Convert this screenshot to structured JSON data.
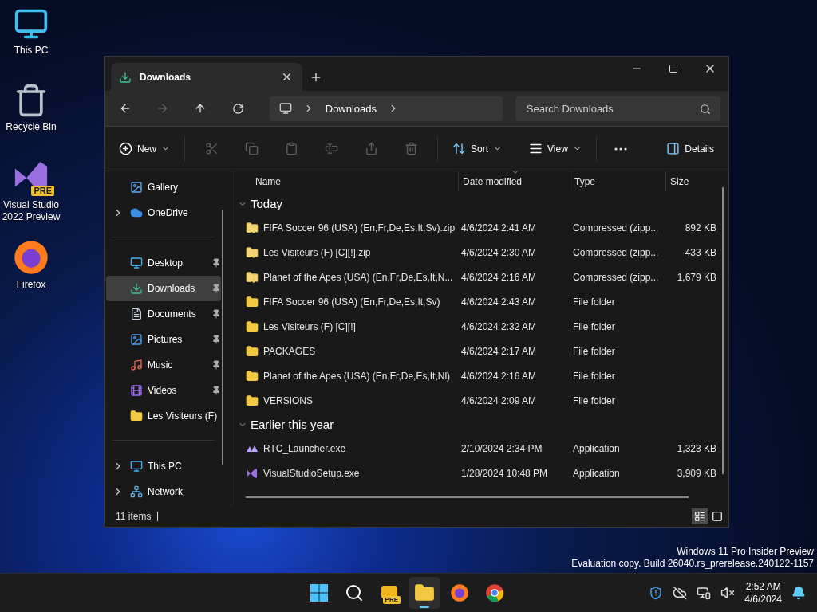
{
  "desktop_icons": [
    {
      "label": "This PC",
      "kind": "pc"
    },
    {
      "label": "Recycle Bin",
      "kind": "bin"
    },
    {
      "label": "Visual Studio 2022 Preview",
      "kind": "vs",
      "badge": "PRE"
    },
    {
      "label": "Firefox",
      "kind": "firefox"
    }
  ],
  "window": {
    "tab": {
      "title": "Downloads",
      "selected": true
    },
    "breadcrumb": [
      "Downloads"
    ],
    "search": {
      "placeholder": "Search Downloads"
    },
    "toolbar": {
      "new_label": "New",
      "actions": [
        {
          "disabled": true
        },
        {
          "disabled": true
        },
        {
          "disabled": true
        },
        {
          "disabled": true
        },
        {
          "disabled": true
        },
        {
          "disabled": true
        }
      ],
      "sort_label": "Sort",
      "view_label": "View",
      "details_label": "Details"
    },
    "sidebar": {
      "sections": [
        {
          "items": [
            {
              "label": "Gallery",
              "kind": "gallery",
              "expandable": false,
              "pinned": false,
              "selected": false
            },
            {
              "label": "OneDrive",
              "kind": "cloud",
              "expandable": true,
              "pinned": false,
              "selected": false
            }
          ]
        },
        {
          "items": [
            {
              "label": "Desktop",
              "kind": "desktop",
              "expandable": false,
              "pinned": true,
              "selected": false
            },
            {
              "label": "Downloads",
              "kind": "download",
              "expandable": false,
              "pinned": true,
              "selected": true
            },
            {
              "label": "Documents",
              "kind": "documents",
              "expandable": false,
              "pinned": true,
              "selected": false
            },
            {
              "label": "Pictures",
              "kind": "pictures",
              "expandable": false,
              "pinned": true,
              "selected": false
            },
            {
              "label": "Music",
              "kind": "music",
              "expandable": false,
              "pinned": true,
              "selected": false
            },
            {
              "label": "Videos",
              "kind": "videos",
              "expandable": false,
              "pinned": true,
              "selected": false
            },
            {
              "label": "Les Visiteurs (F)",
              "kind": "folder",
              "expandable": false,
              "pinned": false,
              "selected": false
            }
          ]
        },
        {
          "items": [
            {
              "label": "This PC",
              "kind": "pc",
              "expandable": true,
              "pinned": false,
              "selected": false
            },
            {
              "label": "Network",
              "kind": "network",
              "expandable": true,
              "pinned": false,
              "selected": false
            }
          ]
        }
      ]
    },
    "table": {
      "columns": [
        {
          "label": "Name",
          "sorted": false
        },
        {
          "label": "Date modified",
          "sorted": true
        },
        {
          "label": "Type",
          "sorted": false
        },
        {
          "label": "Size",
          "sorted": false
        }
      ],
      "groups": [
        {
          "title": "Today",
          "expanded": true,
          "rows": [
            {
              "kind": "zip",
              "name": "FIFA Soccer 96 (USA) (En,Fr,De,Es,It,Sv).zip",
              "date": "4/6/2024 2:41 AM",
              "type": "Compressed (zipp...",
              "size": "892 KB"
            },
            {
              "kind": "zip",
              "name": "Les Visiteurs (F) [C][!].zip",
              "date": "4/6/2024 2:30 AM",
              "type": "Compressed (zipp...",
              "size": "433 KB"
            },
            {
              "kind": "zip",
              "name": "Planet of the Apes (USA) (En,Fr,De,Es,It,N...",
              "date": "4/6/2024 2:16 AM",
              "type": "Compressed (zipp...",
              "size": "1,679 KB"
            },
            {
              "kind": "folder",
              "name": "FIFA Soccer 96 (USA) (En,Fr,De,Es,It,Sv)",
              "date": "4/6/2024 2:43 AM",
              "type": "File folder"
            },
            {
              "kind": "folder",
              "name": "Les Visiteurs (F) [C][!]",
              "date": "4/6/2024 2:32 AM",
              "type": "File folder"
            },
            {
              "kind": "folder",
              "name": "PACKAGES",
              "date": "4/6/2024 2:17 AM",
              "type": "File folder"
            },
            {
              "kind": "folder",
              "name": "Planet of the Apes (USA) (En,Fr,De,Es,It,Nl)",
              "date": "4/6/2024 2:16 AM",
              "type": "File folder"
            },
            {
              "kind": "folder",
              "name": "VERSIONS",
              "date": "4/6/2024 2:09 AM",
              "type": "File folder"
            }
          ]
        },
        {
          "title": "Earlier this year",
          "expanded": true,
          "rows": [
            {
              "kind": "rtc",
              "name": "RTC_Launcher.exe",
              "date": "2/10/2024 2:34 PM",
              "type": "Application",
              "size": "1,323 KB"
            },
            {
              "kind": "vs",
              "name": "VisualStudioSetup.exe",
              "date": "1/28/2024 10:48 PM",
              "type": "Application",
              "size": "3,909 KB"
            }
          ]
        }
      ]
    },
    "status_bar": {
      "count": "11 items",
      "views": [
        {
          "kind": "details",
          "selected": true
        },
        {
          "kind": "tiles",
          "selected": false
        }
      ]
    }
  },
  "watermark_os": [
    "Windows 11 Pro Insider Preview",
    "Evaluation copy. Build 26040.rs_prerelease.240122-1157"
  ],
  "taskbar": {
    "apps": [
      {
        "kind": "start",
        "selected": false
      },
      {
        "kind": "search",
        "selected": false
      },
      {
        "kind": "dev",
        "selected": false,
        "badge": "PRE"
      },
      {
        "kind": "explorer",
        "selected": true
      },
      {
        "kind": "firefox",
        "selected": false
      },
      {
        "kind": "chrome",
        "selected": false
      }
    ],
    "time": "2:52 AM",
    "date": "4/6/2024"
  }
}
